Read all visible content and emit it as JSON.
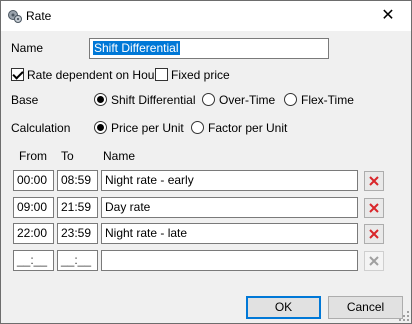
{
  "window": {
    "title": "Rate",
    "close_glyph": "✕"
  },
  "form": {
    "name_label": "Name",
    "name_value": "Shift Differential",
    "rate_dependent_label": "Rate dependent on Hours",
    "rate_dependent_checked": true,
    "fixed_price_label": "Fixed price",
    "fixed_price_checked": false,
    "base_label": "Base",
    "base_options": [
      "Shift Differential",
      "Over-Time",
      "Flex-Time"
    ],
    "base_selected": "Shift Differential",
    "calc_label": "Calculation",
    "calc_options": [
      "Price per Unit",
      "Factor per Unit"
    ],
    "calc_selected": "Price per Unit"
  },
  "table": {
    "headers": {
      "from": "From",
      "to": "To",
      "name": "Name"
    },
    "rows": [
      {
        "from": "00:00",
        "to": "08:59",
        "name": "Night rate - early"
      },
      {
        "from": "09:00",
        "to": "21:59",
        "name": "Day rate"
      },
      {
        "from": "22:00",
        "to": "23:59",
        "name": "Night rate - late"
      },
      {
        "from": "__:__",
        "to": "__:__",
        "name": ""
      }
    ]
  },
  "buttons": {
    "ok": "OK",
    "cancel": "Cancel"
  },
  "icons": {
    "app": "rate-app-icon",
    "delete": "delete-x-icon",
    "delete_color": "#d9262a",
    "delete_disabled_color": "#a0a0a0",
    "accent": "#0078d7"
  }
}
